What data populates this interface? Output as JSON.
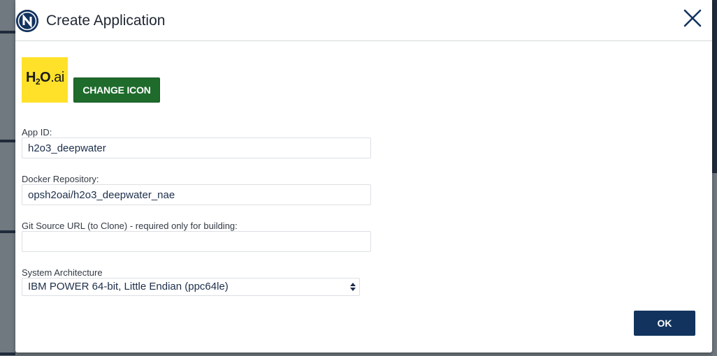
{
  "dialog": {
    "title": "Create Application",
    "logo_letter": "N",
    "close_icon": "close-icon"
  },
  "app_icon": {
    "text_h": "H",
    "text_sub": "2",
    "text_o": "O",
    "text_ai": ".ai",
    "background": "#ffe12a",
    "change_label": "CHANGE ICON"
  },
  "form": {
    "app_id": {
      "label": "App ID:",
      "value": "h2o3_deepwater"
    },
    "docker_repo": {
      "label": "Docker Repository:",
      "value": "opsh2oai/h2o3_deepwater_nae"
    },
    "git_url": {
      "label": "Git Source URL (to Clone) - required only for building:",
      "value": ""
    },
    "architecture": {
      "label": "System Architecture",
      "selected": "IBM POWER 64-bit, Little Endian (ppc64le)"
    }
  },
  "actions": {
    "ok_label": "OK"
  },
  "colors": {
    "brand_navy": "#12335e",
    "change_icon_green": "#1e6b2c",
    "input_text": "#1c2e4a"
  }
}
